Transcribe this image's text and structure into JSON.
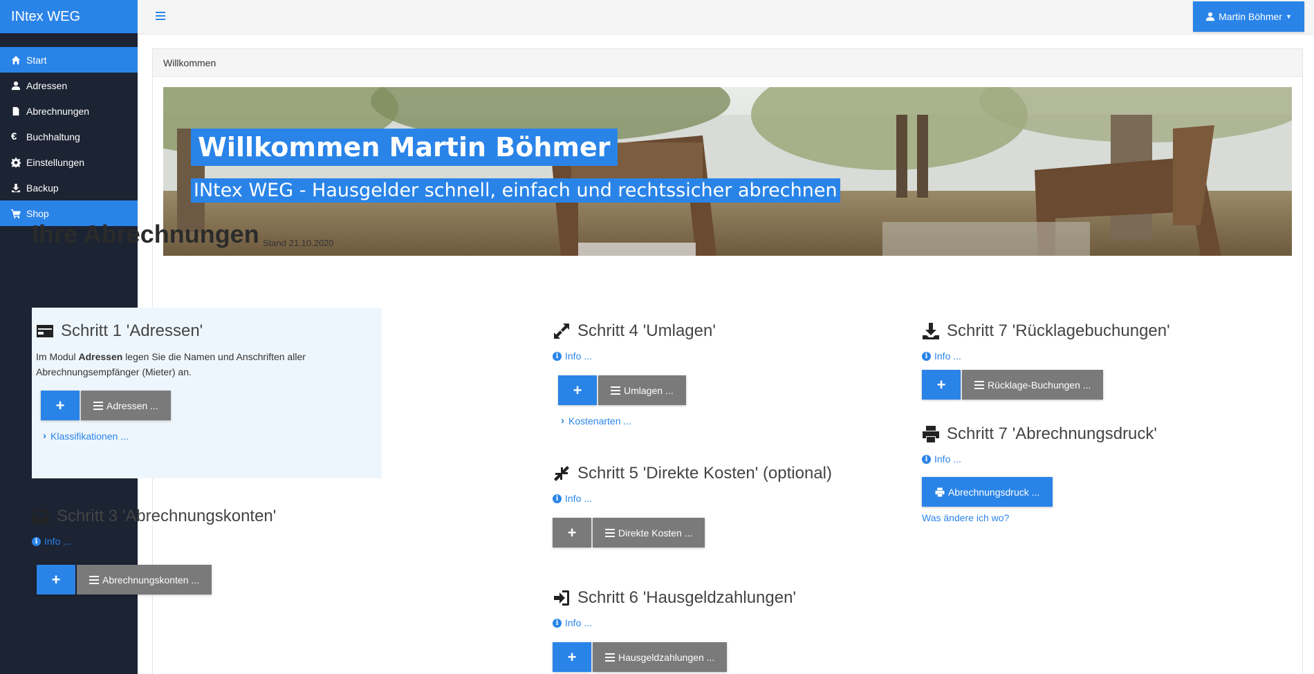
{
  "app": {
    "brand": "INtex WEG"
  },
  "sidebar": {
    "items": [
      {
        "label": "Start",
        "icon": "home-icon",
        "active": true
      },
      {
        "label": "Adressen",
        "icon": "user-icon",
        "active": false
      },
      {
        "label": "Abrechnungen",
        "icon": "file-icon",
        "active": false
      },
      {
        "label": "Buchhaltung",
        "icon": "euro-icon",
        "active": false
      },
      {
        "label": "Einstellungen",
        "icon": "gear-icon",
        "active": false
      },
      {
        "label": "Backup",
        "icon": "download-icon",
        "active": false
      },
      {
        "label": "Shop",
        "icon": "cart-icon",
        "active": true
      }
    ]
  },
  "topbar": {
    "user": "Martin Böhmer"
  },
  "panel": {
    "breadcrumb": "Willkommen"
  },
  "banner": {
    "title": "Willkommen Martin Böhmer",
    "subtitle": "INtex WEG - Hausgelder schnell, einfach und rechtssicher abrechnen"
  },
  "heading": {
    "title": "Ihre Abrechnungen",
    "stand": "Stand 21.10.2020"
  },
  "steps": {
    "s1": {
      "title": "Schritt 1 'Adressen'",
      "desc_prefix": "Im Modul ",
      "desc_bold": "Adressen",
      "desc_suffix": " legen Sie die Namen und Anschriften aller Abrechnungsempfänger (Mieter) an.",
      "button": "Adressen ...",
      "link": "Klassifikationen ..."
    },
    "s3": {
      "title": "Schritt 3 'Abrechnungskonten'",
      "info": "Info ...",
      "button": "Abrechnungskonten ..."
    },
    "s4": {
      "title": "Schritt 4 'Umlagen'",
      "info": "Info ...",
      "button": "Umlagen ...",
      "link": "Kostenarten ..."
    },
    "s5": {
      "title": "Schritt 5 'Direkte Kosten' (optional)",
      "info": "Info ...",
      "button": "Direkte Kosten ..."
    },
    "s6": {
      "title": "Schritt 6 'Hausgeldzahlungen'",
      "info": "Info ...",
      "button": "Hausgeldzahlungen ..."
    },
    "s7a": {
      "title": "Schritt 7 'Rücklagebuchungen'",
      "info": "Info ...",
      "button": "Rücklage-Buchungen ..."
    },
    "s7b": {
      "title": "Schritt 7 'Abrechnungsdruck'",
      "info": "Info ...",
      "button": "Abrechnungsdruck ...",
      "link": "Was ändere ich wo?"
    }
  },
  "colors": {
    "accent": "#2a84e8",
    "sidebar": "#1c2333",
    "button_grey": "#7a7a7a",
    "step_highlight": "#eef6fd"
  }
}
